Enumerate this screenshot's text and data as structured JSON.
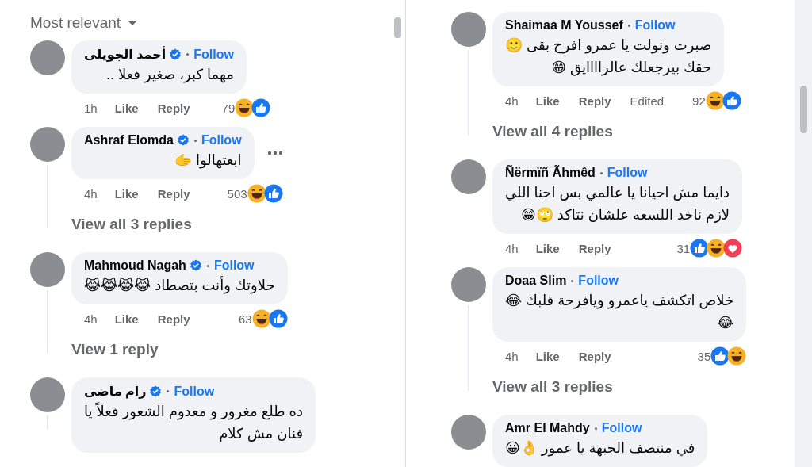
{
  "left_panel": {
    "sort_menu": {
      "label": "Most relevant"
    },
    "comments": [
      {
        "name": "أحمد الجويلى",
        "verified": true,
        "follow": "Follow",
        "text": "مهما كبر، صغير فعلا ..",
        "time": "1h",
        "like": "Like",
        "reply": "Reply",
        "count": "79",
        "reactions": [
          {
            "kind": "haha"
          },
          {
            "kind": "like"
          }
        ],
        "thread": false
      },
      {
        "name": "Ashraf Elomda",
        "verified": true,
        "follow": "Follow",
        "text": "ابعتهالوا 🫱",
        "time": "4h",
        "like": "Like",
        "reply": "Reply",
        "count": "503",
        "reactions": [
          {
            "kind": "haha"
          },
          {
            "kind": "like"
          }
        ],
        "more_menu": true,
        "thread": true,
        "view_replies": "View all 3 replies"
      },
      {
        "name": "Mahmoud Nagah",
        "verified": true,
        "follow": "Follow",
        "text": "حلاوتك وأنت بتصطاد 😹😹😹😹",
        "time": "4h",
        "like": "Like",
        "reply": "Reply",
        "count": "63",
        "reactions": [
          {
            "kind": "haha"
          },
          {
            "kind": "like"
          }
        ],
        "thread": true,
        "view_replies": "View 1 reply"
      },
      {
        "name": "رام ماضى",
        "verified": true,
        "follow": "Follow",
        "text": "ده طلع مغرور و معدوم الشعور فعلاً يا\nفنان مش كلام",
        "thread": true
      }
    ]
  },
  "right_panel": {
    "comments": [
      {
        "name": "Shaimaa M Youssef",
        "verified": false,
        "follow": "Follow",
        "text": "صبرت ونولت يا عمرو افرح بقى 🙂\nحقك بيرجعلك عالراااايق 😁",
        "time": "4h",
        "like": "Like",
        "reply": "Reply",
        "edited": "Edited",
        "count": "92",
        "reactions": [
          {
            "kind": "haha"
          },
          {
            "kind": "like"
          }
        ],
        "thread": true,
        "view_replies": "View all 4 replies"
      },
      {
        "name": "Ñërmïñ Ãhmêd",
        "verified": false,
        "follow": "Follow",
        "text": "دايما مش احيانا يا عالمي بس احنا اللي\nلازم ناخد اللسعه علشان نتاكد 🙄😁",
        "time": "4h",
        "like": "Like",
        "reply": "Reply",
        "count": "31",
        "reactions": [
          {
            "kind": "like"
          },
          {
            "kind": "haha"
          },
          {
            "kind": "love"
          }
        ],
        "thread": false
      },
      {
        "name": "Doaa Slim",
        "verified": false,
        "follow": "Follow",
        "text": "خلاص اتكشف ياعمرو ويافرحة قلبك 😂\n😂",
        "time": "4h",
        "like": "Like",
        "reply": "Reply",
        "count": "35",
        "reactions": [
          {
            "kind": "like"
          },
          {
            "kind": "haha"
          }
        ],
        "thread": true,
        "view_replies": "View all 3 replies"
      },
      {
        "name": "Amr El Mahdy",
        "verified": false,
        "follow": "Follow",
        "text": "في منتصف الجبهة يا عمور 👌😀",
        "thread": false
      }
    ]
  }
}
